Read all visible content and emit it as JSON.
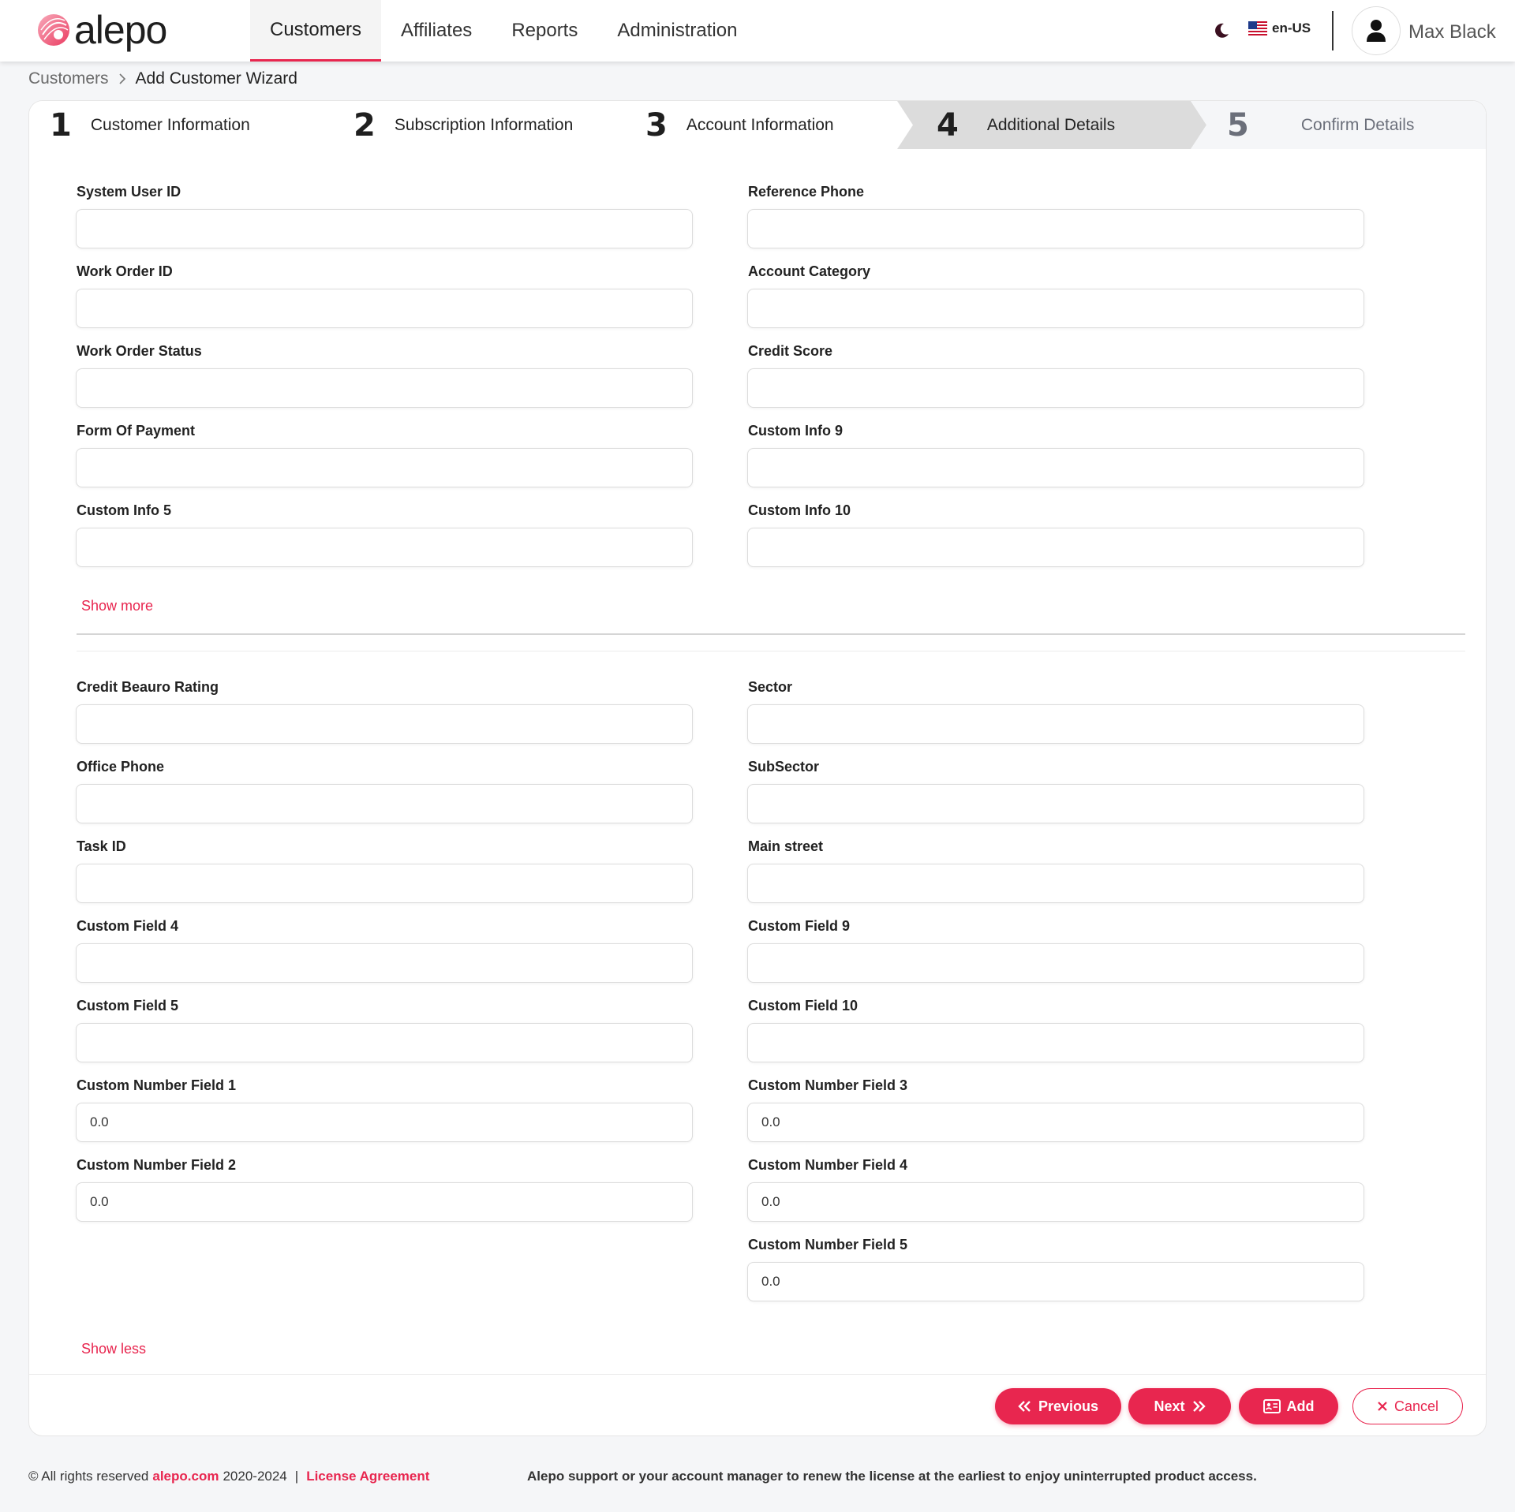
{
  "header": {
    "logo_text": "alepo",
    "nav": [
      "Customers",
      "Affiliates",
      "Reports",
      "Administration"
    ],
    "active_nav": "Customers",
    "language": "en-US",
    "user_name": "Max Black"
  },
  "breadcrumb": {
    "parent": "Customers",
    "current": "Add Customer Wizard"
  },
  "wizard": {
    "steps": [
      {
        "num": "1",
        "label": "Customer Information"
      },
      {
        "num": "2",
        "label": "Subscription Information"
      },
      {
        "num": "3",
        "label": "Account Information"
      },
      {
        "num": "4",
        "label": "Additional Details"
      },
      {
        "num": "5",
        "label": "Confirm Details"
      }
    ],
    "current_step": "4"
  },
  "form": {
    "section1": {
      "left": [
        {
          "label": "System User ID",
          "value": ""
        },
        {
          "label": "Work Order ID",
          "value": ""
        },
        {
          "label": "Work Order Status",
          "value": ""
        },
        {
          "label": "Form Of Payment",
          "value": ""
        },
        {
          "label": "Custom Info 5",
          "value": ""
        }
      ],
      "right": [
        {
          "label": "Reference Phone",
          "value": ""
        },
        {
          "label": "Account Category",
          "value": ""
        },
        {
          "label": "Credit Score",
          "value": ""
        },
        {
          "label": "Custom Info 9",
          "value": ""
        },
        {
          "label": "Custom Info 10",
          "value": ""
        }
      ],
      "show_more": "Show more"
    },
    "section2": {
      "left": [
        {
          "label": "Credit Beauro Rating",
          "value": ""
        },
        {
          "label": "Office Phone",
          "value": ""
        },
        {
          "label": "Task ID",
          "value": ""
        },
        {
          "label": "Custom Field 4",
          "value": ""
        },
        {
          "label": "Custom Field 5",
          "value": ""
        },
        {
          "label": "Custom Number Field 1",
          "value": "0.0"
        },
        {
          "label": "Custom Number Field 2",
          "value": "0.0"
        }
      ],
      "right": [
        {
          "label": "Sector",
          "value": ""
        },
        {
          "label": "SubSector",
          "value": ""
        },
        {
          "label": "Main street",
          "value": ""
        },
        {
          "label": "Custom Field 9",
          "value": ""
        },
        {
          "label": "Custom Field 10",
          "value": ""
        },
        {
          "label": "Custom Number Field 3",
          "value": "0.0"
        },
        {
          "label": "Custom Number Field 4",
          "value": "0.0"
        },
        {
          "label": "Custom Number Field 5",
          "value": "0.0"
        }
      ],
      "show_less": "Show less"
    }
  },
  "actions": {
    "previous": "Previous",
    "next": "Next",
    "add": "Add",
    "cancel": "Cancel"
  },
  "footer": {
    "rights_prefix": "© All rights reserved",
    "site": "alepo.com",
    "years": "2020-2024",
    "separator": "|",
    "license_link": "License Agreement",
    "license_message": "Alepo support or your account manager to renew the license at the earliest to enjoy uninterrupted product access."
  },
  "colors": {
    "accent": "#e8264f",
    "step_current_bg": "#dcdcdc"
  },
  "icons": [
    "logo-mark",
    "moon-icon",
    "us-flag-icon",
    "user-icon",
    "chevron-right-icon",
    "double-chevron-left-icon",
    "double-chevron-right-icon",
    "id-card-icon",
    "close-icon"
  ]
}
